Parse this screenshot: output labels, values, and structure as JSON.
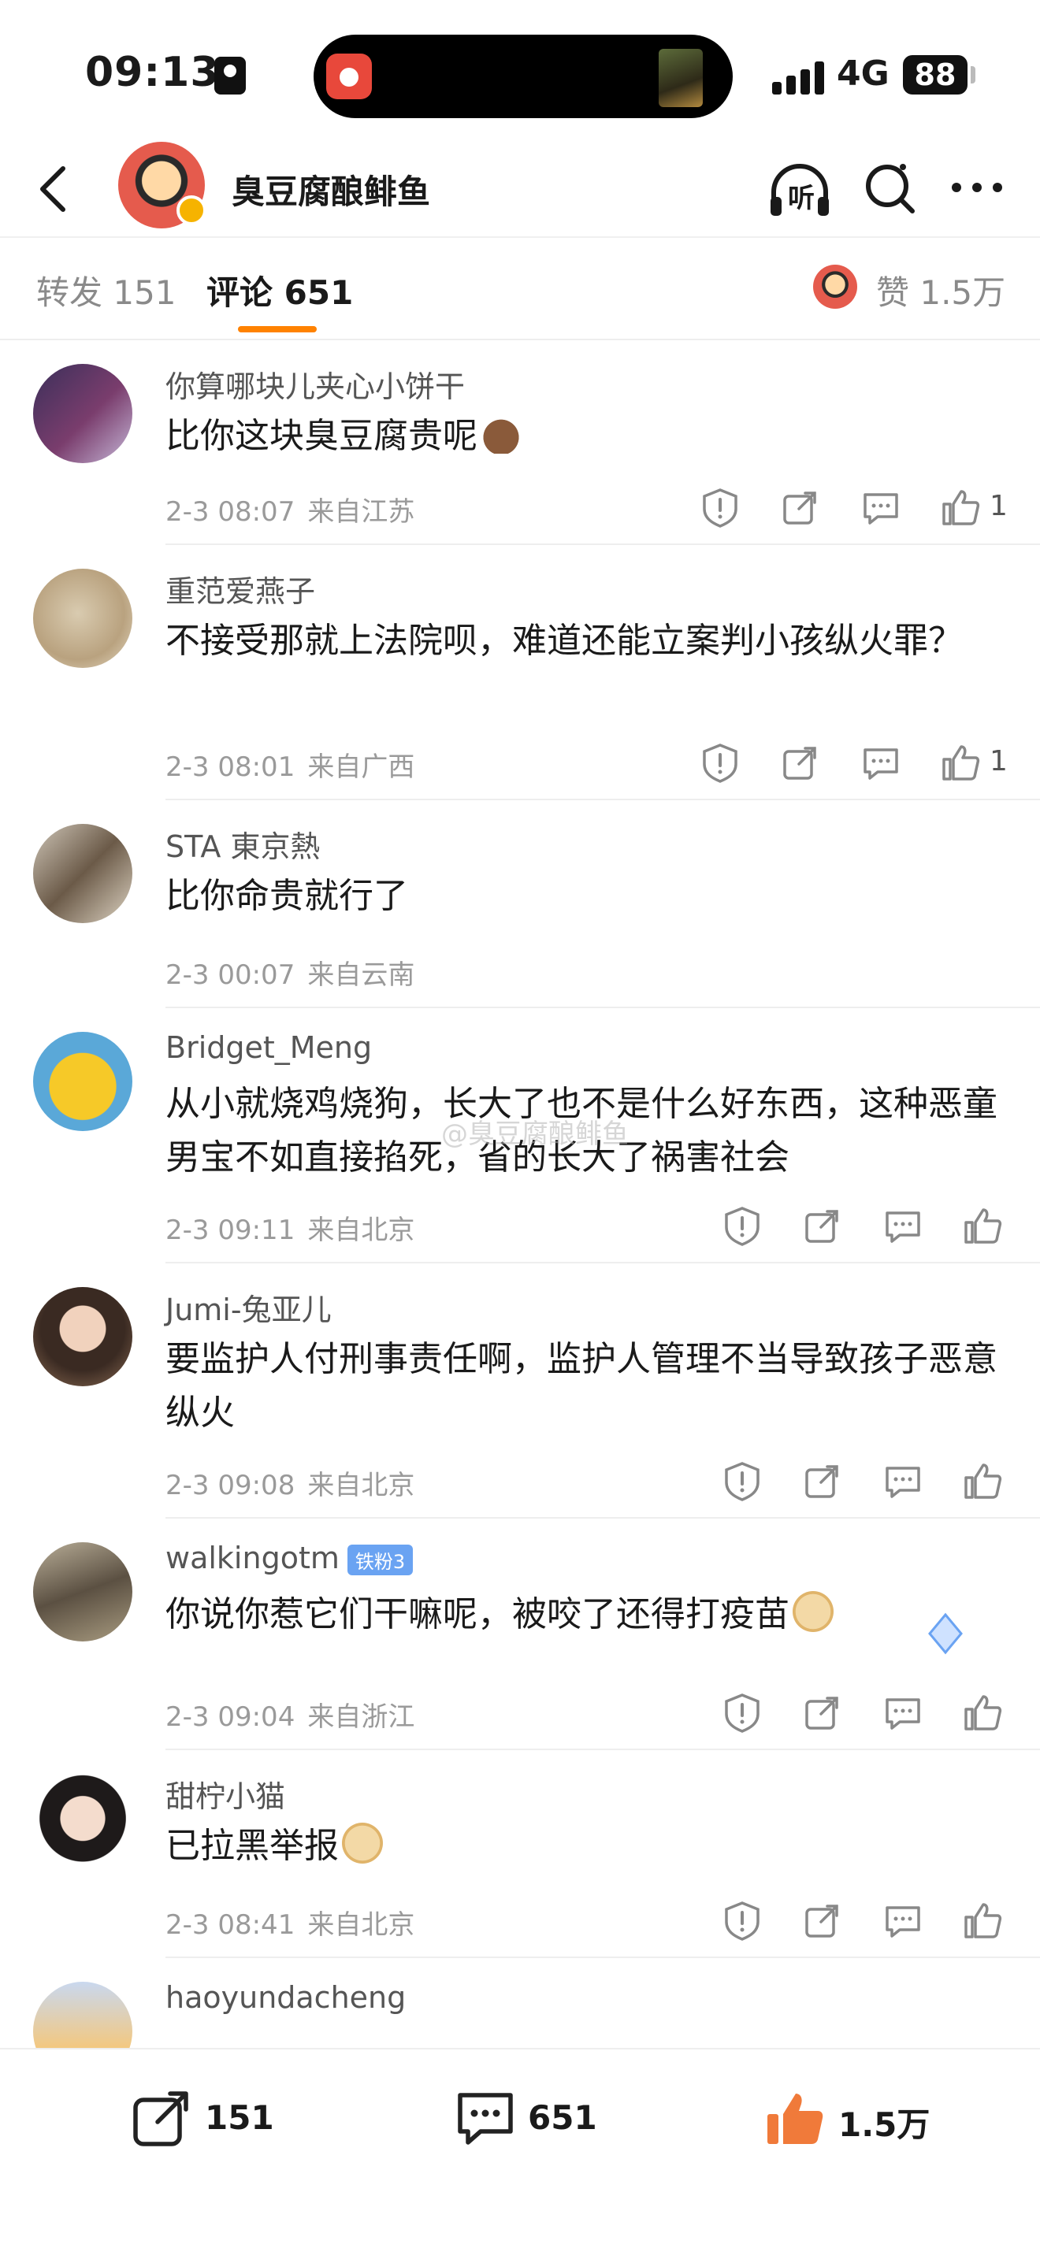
{
  "status_bar": {
    "time": "09:13",
    "network": "4G",
    "battery": "88"
  },
  "header": {
    "account_name": "臭豆腐酿鲱鱼",
    "listen_label": "听"
  },
  "tabs": {
    "repost": "转发 151",
    "comments": "评论 651",
    "likes": "赞 1.5万"
  },
  "comments": [
    {
      "user": "你算哪块儿夹心小饼干",
      "text": "比你这块臭豆腐贵呢",
      "emoji": "poop",
      "time": "2-3 08:07",
      "location": "来自江苏",
      "likes": "1"
    },
    {
      "user": "重范爱燕子",
      "text": "不接受那就上法院呗，难道还能立案判小孩纵火罪？",
      "time": "2-3 08:01",
      "location": "来自广西",
      "likes": "1"
    },
    {
      "user": "STA 東京熱",
      "text": "比你命贵就行了",
      "time": "2-3 00:07",
      "location": "来自云南",
      "likes": ""
    },
    {
      "user": "Bridget_Meng",
      "text": "从小就烧鸡烧狗，长大了也不是什么好东西，这种恶童男宝不如直接掐死，省的长大了祸害社会",
      "time": "2-3 09:11",
      "location": "来自北京",
      "likes": ""
    },
    {
      "user": "Jumi-兔亚儿",
      "text": "要监护人付刑事责任啊，监护人管理不当导致孩子恶意纵火",
      "time": "2-3 09:08",
      "location": "来自北京",
      "likes": ""
    },
    {
      "user": "walkingotm",
      "badge": "铁粉3",
      "text": "你说你惹它们干嘛呢，被咬了还得打疫苗",
      "emoji": "doge",
      "time": "2-3 09:04",
      "location": "来自浙江",
      "likes": ""
    },
    {
      "user": "甜柠小猫",
      "text": "已拉黑举报",
      "emoji": "doge",
      "time": "2-3 08:41",
      "location": "来自北京",
      "likes": ""
    },
    {
      "user": "haoyundacheng",
      "text": "",
      "time": "",
      "location": "",
      "likes": ""
    }
  ],
  "watermark": "@臭豆腐酿鲱鱼",
  "bottom_bar": {
    "repost_count": "151",
    "comment_count": "651",
    "like_count": "1.5万"
  },
  "colors": {
    "accent": "#ff8200",
    "like_active": "#f07a3a",
    "badge": "#6aa3f2"
  },
  "icons": [
    "back-arrow-icon",
    "headphones-icon",
    "search-icon",
    "more-icon",
    "report-icon",
    "share-icon",
    "comment-icon",
    "thumbs-up-icon",
    "poop-emoji-icon",
    "doge-emoji-icon"
  ]
}
